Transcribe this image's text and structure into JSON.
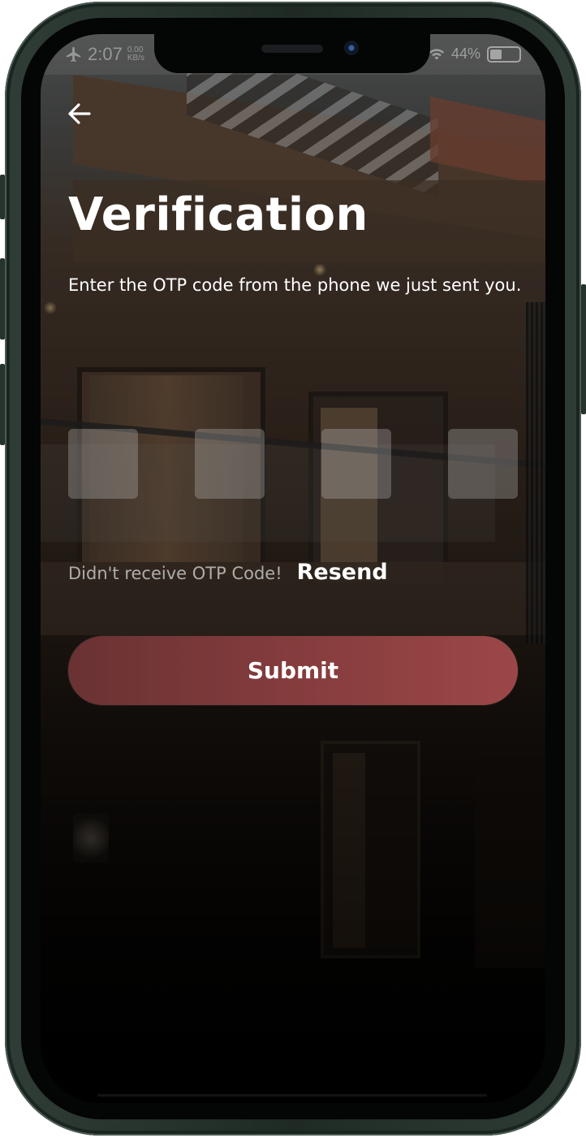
{
  "status_bar": {
    "time": "2:07",
    "net_speed": "0.00",
    "net_unit": "KB/s",
    "battery": "44%",
    "airplane_icon": "airplane-icon",
    "wifi_icon": "wifi-icon",
    "battery_icon": "battery-icon"
  },
  "header": {
    "back_icon": "arrow-left-icon",
    "title": "Verification",
    "subtitle": "Enter the OTP code from the phone we just sent you."
  },
  "otp": {
    "boxes": [
      "",
      "",
      "",
      ""
    ]
  },
  "resend": {
    "prompt": "Didn't receive OTP Code!",
    "link": "Resend"
  },
  "actions": {
    "submit_label": "Submit"
  },
  "colors": {
    "accent": "#8a3e3f",
    "text": "#ffffff"
  }
}
